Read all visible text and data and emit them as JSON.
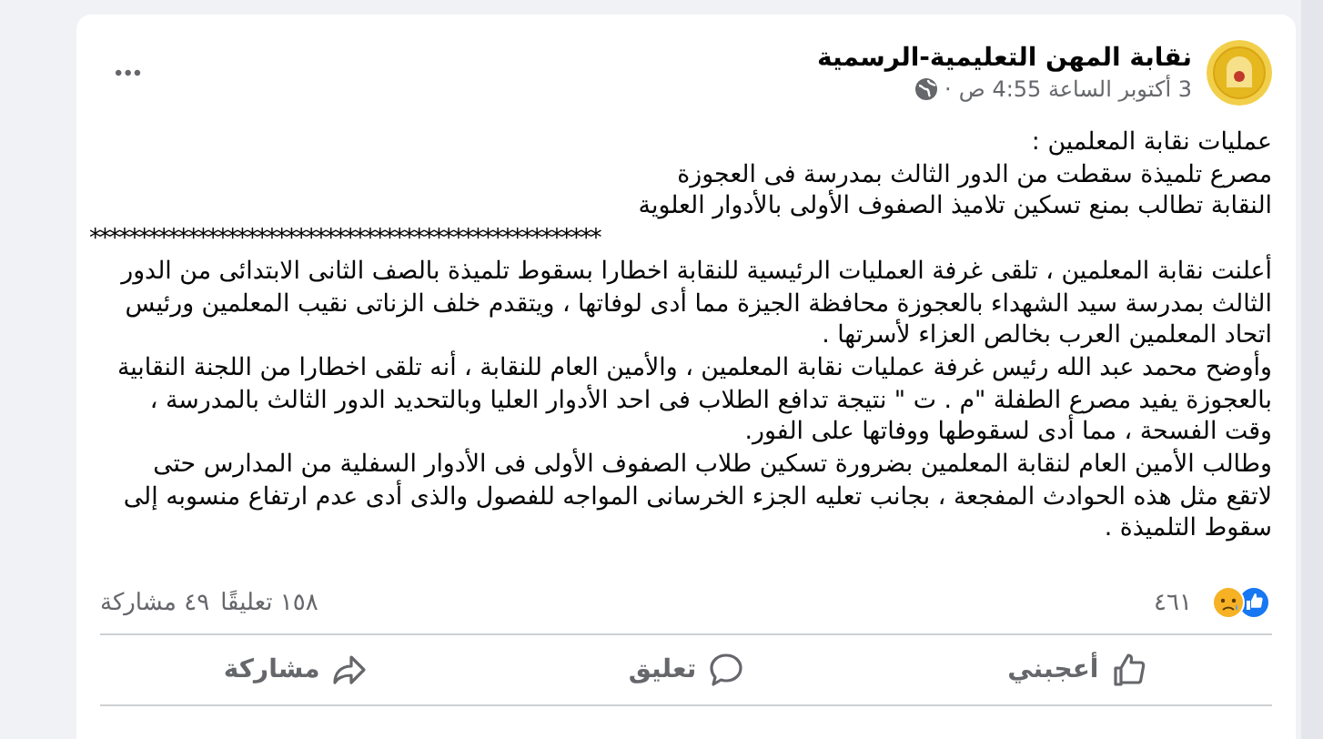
{
  "post": {
    "author": "نقابة المهن التعليمية-الرسمية",
    "time": "3 أكتوبر الساعة 4:55 ص",
    "separator": "·",
    "menu": "•••",
    "headline": [
      "عمليات نقابة المعلمين :",
      "مصرع تلميذة سقطت من الدور الثالث بمدرسة فى العجوزة",
      "النقابة تطالب بمنع تسكين تلاميذ الصفوف الأولى بالأدوار العلوية"
    ],
    "divider": "****************************************************",
    "paragraphs": [
      "أعلنت نقابة المعلمين ، تلقى غرفة العمليات الرئيسية للنقابة اخطارا بسقوط تلميذة بالصف الثانى الابتدائى من الدور الثالث بمدرسة سيد الشهداء بالعجوزة محافظة الجيزة مما أدى لوفاتها ، ويتقدم خلف الزناتى نقيب المعلمين ورئيس اتحاد المعلمين العرب بخالص العزاء لأسرتها .",
      "وأوضح محمد عبد الله رئيس غرفة عمليات نقابة المعلمين ، والأمين العام للنقابة ، أنه تلقى اخطارا من اللجنة النقابية بالعجوزة يفيد مصرع الطفلة \"م . ت \" نتيجة تدافع الطلاب فى احد الأدوار العليا وبالتحديد الدور الثالث بالمدرسة ، وقت الفسحة ، مما أدى لسقوطها ووفاتها على الفور.",
      "وطالب الأمين العام لنقابة المعلمين بضرورة تسكين طلاب الصفوف الأولى فى الأدوار السفلية من المدارس حتى لاتقع مثل هذه الحوادث المفجعة ، بجانب تعليه الجزء الخرسانى المواجه للفصول والذى أدى عدم ارتفاع منسوبه إلى سقوط التلميذة ."
    ]
  },
  "stats": {
    "reactions": "٤٦١",
    "comments": "١٥٨ تعليقًا",
    "shares": "٤٩ مشاركة"
  },
  "actions": [
    {
      "kind": "like",
      "label": "أعجبني"
    },
    {
      "kind": "comment",
      "label": "تعليق"
    },
    {
      "kind": "share",
      "label": "مشاركة"
    }
  ]
}
